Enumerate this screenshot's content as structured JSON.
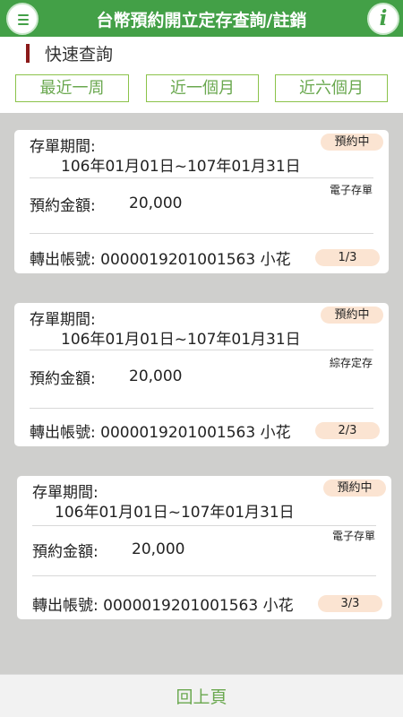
{
  "header": {
    "title": "台幣預約開立定存查詢/註銷",
    "info_glyph": "i",
    "menu_icon": "hamburger-menu-icon",
    "info_icon": "info-icon",
    "accent_color": "#43a047"
  },
  "quick_query": {
    "title": "快速查詢",
    "ranges": [
      "最近一周",
      "近一個月",
      "近六個月"
    ]
  },
  "records": [
    {
      "period_label": "存單期間:",
      "period_value": "106年01月01日~107年01月31日",
      "status": "預約中",
      "amount_label": "預約金額:",
      "amount": "20,000",
      "deposit_type": "電子存單",
      "account": "轉出帳號: 0000019201001563 小花",
      "page": "1/3"
    },
    {
      "period_label": "存單期間:",
      "period_value": "106年01月01日~107年01月31日",
      "status": "預約中",
      "amount_label": "預約金額:",
      "amount": "20,000",
      "deposit_type": "綜存定存",
      "account": "轉出帳號: 0000019201001563 小花",
      "page": "2/3"
    },
    {
      "period_label": "存單期間:",
      "period_value": "106年01月01日~107年01月31日",
      "status": "預約中",
      "amount_label": "預約金額:",
      "amount": "20,000",
      "deposit_type": "電子存單",
      "account": "轉出帳號: 0000019201001563 小花",
      "page": "3/3"
    }
  ],
  "footer": {
    "back_label": "回上頁"
  }
}
